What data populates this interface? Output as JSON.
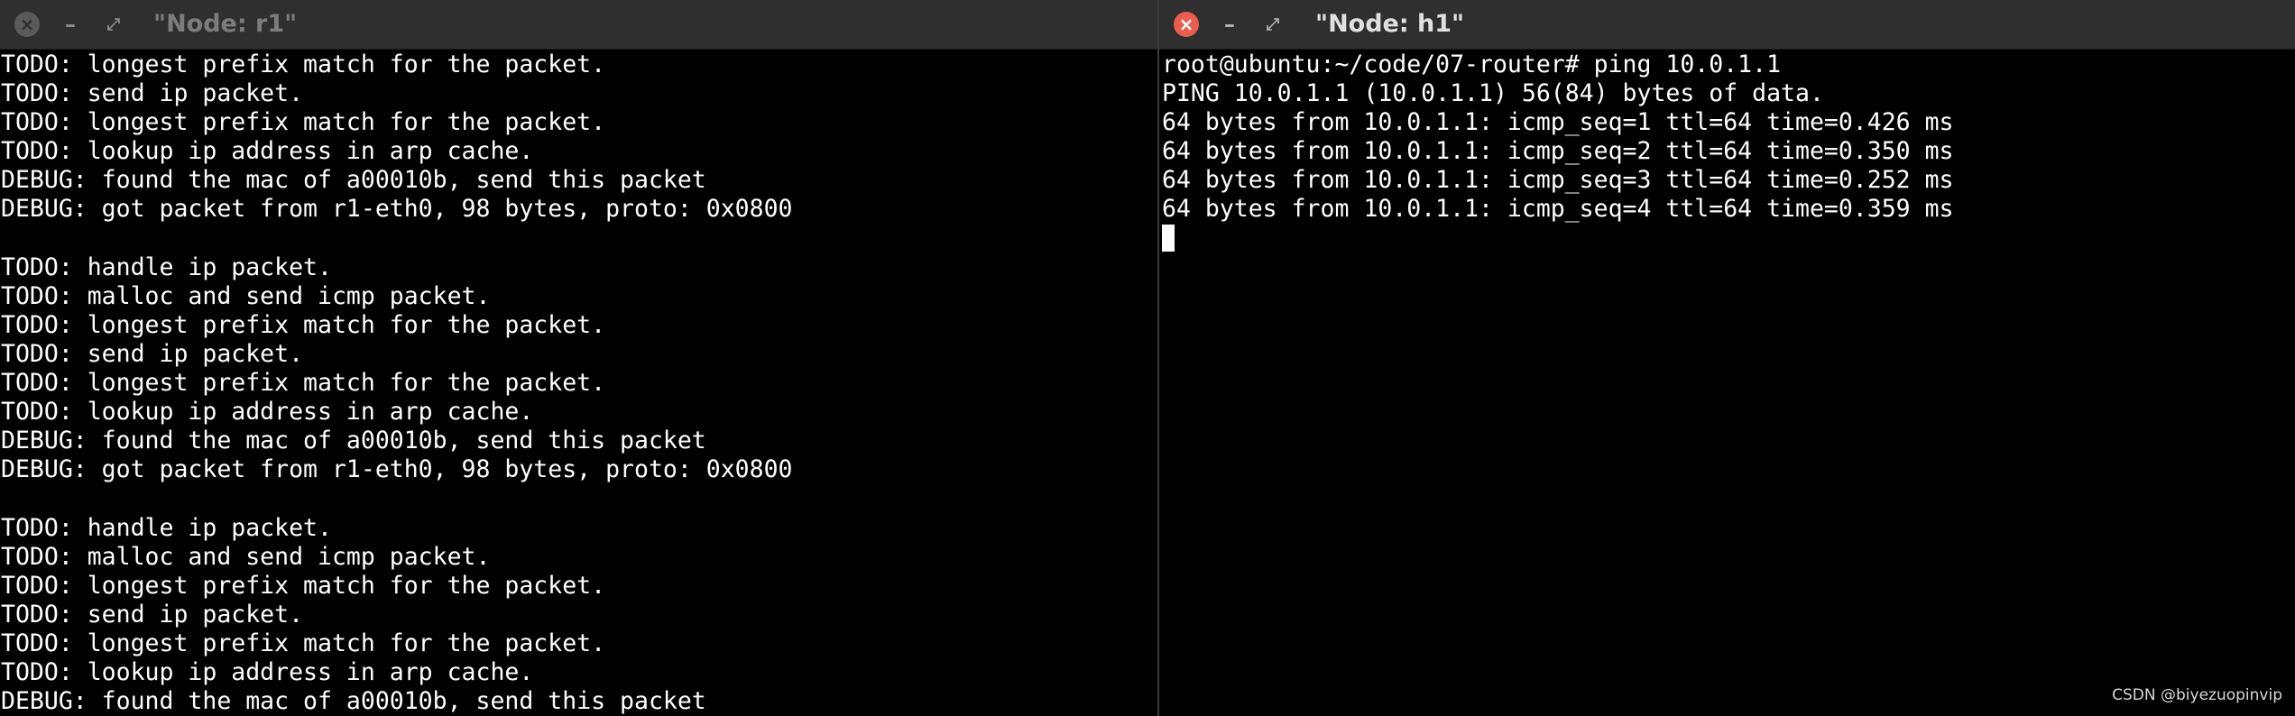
{
  "windows": {
    "left": {
      "title": "\"Node: r1\"",
      "lines": [
        "TODO: longest prefix match for the packet.",
        "TODO: send ip packet.",
        "TODO: longest prefix match for the packet.",
        "TODO: lookup ip address in arp cache.",
        "DEBUG: found the mac of a00010b, send this packet",
        "DEBUG: got packet from r1-eth0, 98 bytes, proto: 0x0800",
        "",
        "TODO: handle ip packet.",
        "TODO: malloc and send icmp packet.",
        "TODO: longest prefix match for the packet.",
        "TODO: send ip packet.",
        "TODO: longest prefix match for the packet.",
        "TODO: lookup ip address in arp cache.",
        "DEBUG: found the mac of a00010b, send this packet",
        "DEBUG: got packet from r1-eth0, 98 bytes, proto: 0x0800",
        "",
        "TODO: handle ip packet.",
        "TODO: malloc and send icmp packet.",
        "TODO: longest prefix match for the packet.",
        "TODO: send ip packet.",
        "TODO: longest prefix match for the packet.",
        "TODO: lookup ip address in arp cache.",
        "DEBUG: found the mac of a00010b, send this packet"
      ]
    },
    "right": {
      "title": "\"Node: h1\"",
      "lines": [
        "root@ubuntu:~/code/07-router# ping 10.0.1.1",
        "PING 10.0.1.1 (10.0.1.1) 56(84) bytes of data.",
        "64 bytes from 10.0.1.1: icmp_seq=1 ttl=64 time=0.426 ms",
        "64 bytes from 10.0.1.1: icmp_seq=2 ttl=64 time=0.350 ms",
        "64 bytes from 10.0.1.1: icmp_seq=3 ttl=64 time=0.252 ms",
        "64 bytes from 10.0.1.1: icmp_seq=4 ttl=64 time=0.359 ms"
      ]
    }
  },
  "icons": {
    "close": "close-icon",
    "minimize": "minimize-icon",
    "maximize": "maximize-icon"
  },
  "watermark": "CSDN @biyezuopinvip",
  "colors": {
    "terminal_bg": "#000000",
    "terminal_fg": "#ffffff",
    "titlebar_bg": "#2f2f2f",
    "close_active": "#e95e50",
    "close_inactive": "#5a5a5a"
  }
}
